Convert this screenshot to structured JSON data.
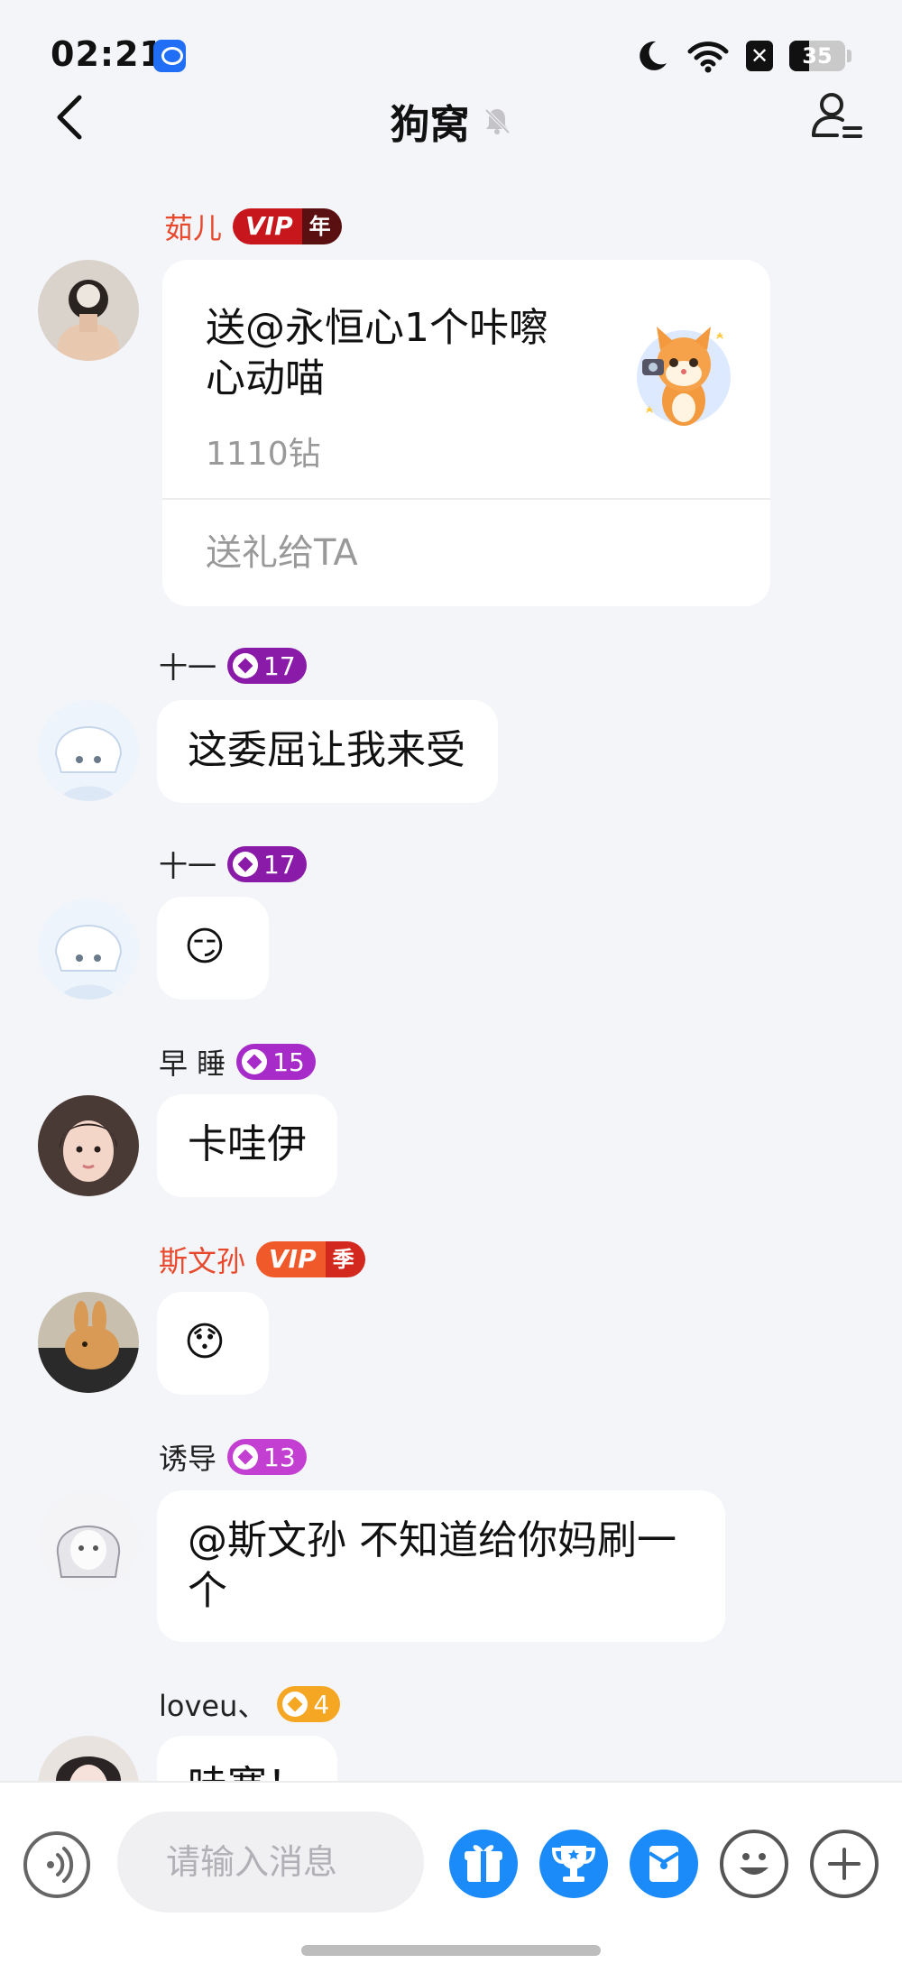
{
  "status_bar": {
    "time": "02:21",
    "battery": "35",
    "battery_level": 0.35
  },
  "header": {
    "title": "狗窝"
  },
  "messages": [
    {
      "name": "茹儿",
      "vip_label": "VIP",
      "vip_period": "年",
      "avatar": "bun-hair-photo-avatar",
      "gift": {
        "title": "送@永恒心1个咔嚓心动喵",
        "price": "1110钻",
        "send_label": "送礼给TA",
        "icon": "orange-cat-camera-gift"
      }
    },
    {
      "name": "十一",
      "level": "17",
      "avatar": "white-hair-anime-avatar",
      "text": "这委屈让我来受"
    },
    {
      "name": "十一",
      "level": "17",
      "avatar": "white-hair-anime-avatar",
      "text": "😏"
    },
    {
      "name": "早 睡",
      "level": "15",
      "avatar": "girl-photo-avatar",
      "text": "卡哇伊"
    },
    {
      "name": "斯文孙",
      "vip_label": "VIP",
      "vip_period": "季",
      "avatar": "bunny-photo-avatar",
      "text": "😯"
    },
    {
      "name": "诱导",
      "level": "13",
      "avatar": "sketch-anime-avatar",
      "text": "@斯文孙 不知道给你妈刷一个"
    },
    {
      "name": "loveu、",
      "level": "4",
      "avatar": "photo-avatar",
      "text": "哇塞！"
    }
  ],
  "input": {
    "placeholder": "请输入消息"
  },
  "colors": {
    "accent": "#1a8bf8",
    "vip_red": "#e8492c",
    "background": "#f4f5f9"
  }
}
